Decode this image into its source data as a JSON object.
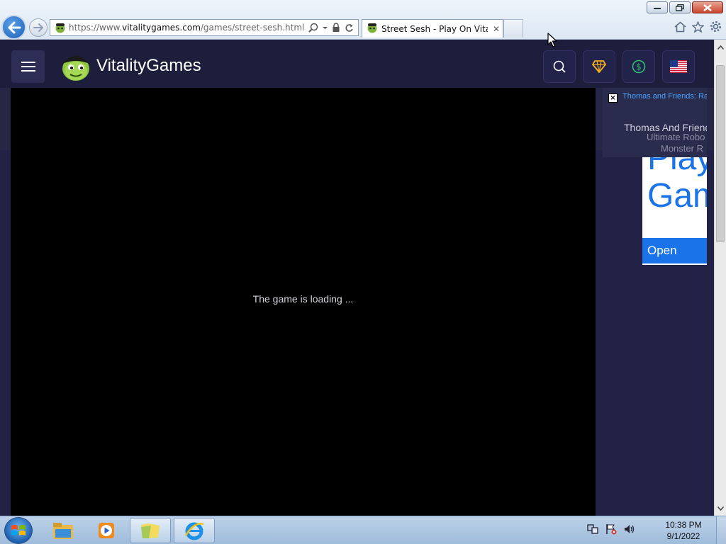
{
  "browser": {
    "url_prefix": "https://www.",
    "url_host": "vitalitygames.com",
    "url_path": "/games/street-sesh.html",
    "tab_title": "Street Sesh - Play On Vitalit...",
    "tab_close": "✕"
  },
  "site": {
    "logo_text": "VitalityGames",
    "header_buttons": [
      "search-icon",
      "gem-icon",
      "dollar-coin-icon",
      "us-flag-icon"
    ]
  },
  "game": {
    "loading_text": "The game is loading ..."
  },
  "suggestions": {
    "close_label": "×",
    "link_text": "Thomas and Friends: Ra",
    "items": [
      "Thomas And Friend",
      "Ultimate Robo",
      "Monster R"
    ]
  },
  "ad": {
    "line1": "Play",
    "line2": "Gam",
    "button": "Open"
  },
  "taskbar": {
    "time": "10:38 PM",
    "date": "9/1/2022",
    "pinned": [
      "windows-explorer-icon",
      "media-player-icon",
      "folder-icon",
      "internet-explorer-icon"
    ]
  },
  "colors": {
    "page_bg": "#262744",
    "header_bg": "#1d1e3b",
    "game_bg": "#000000",
    "ad_blue": "#1a73e8",
    "link_blue": "#4aa3ff"
  }
}
